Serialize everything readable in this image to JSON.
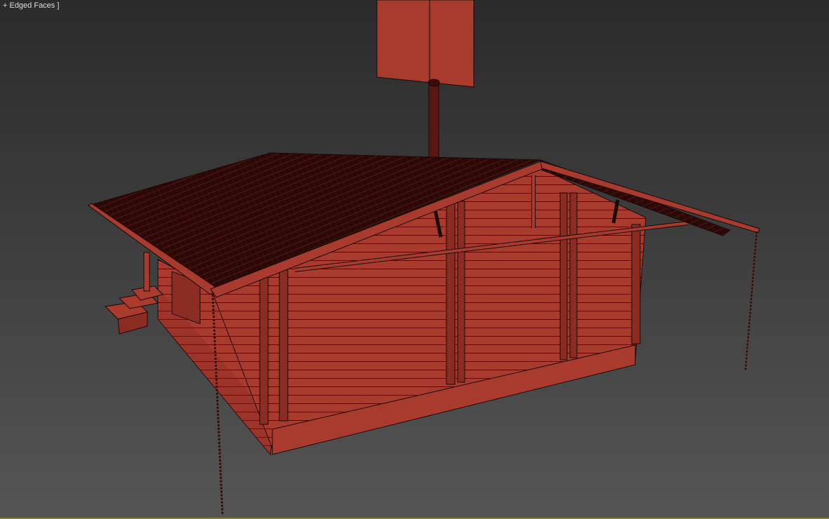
{
  "viewport": {
    "label": "+ Edged Faces ]",
    "model_color": "#a83a2e",
    "edge_color": "#1a0a08",
    "roof_color": "#2a0806"
  }
}
